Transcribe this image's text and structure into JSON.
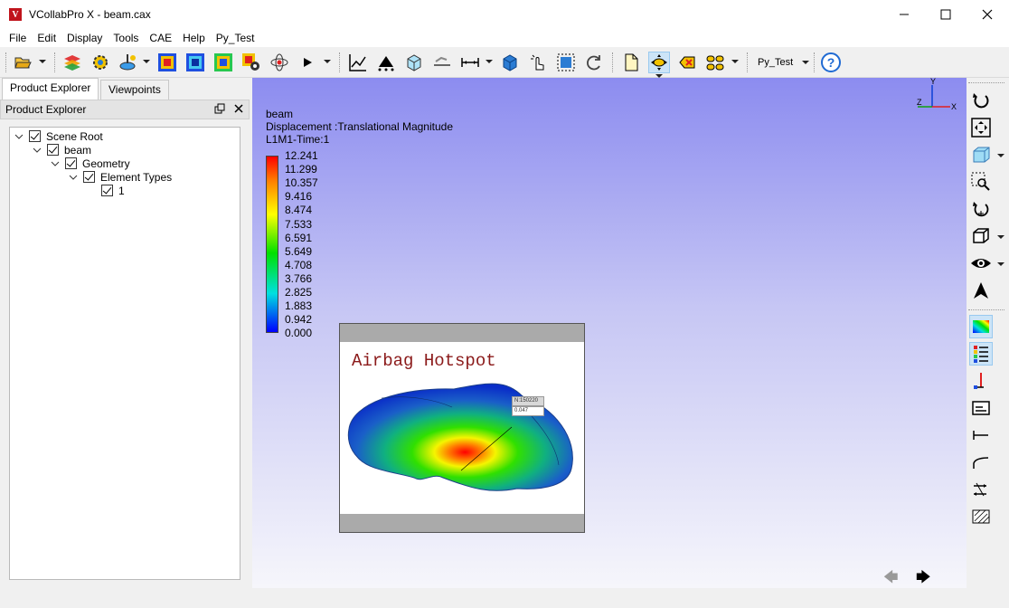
{
  "window": {
    "title": "VCollabPro X - beam.cax",
    "app_icon_letter": "V"
  },
  "menu": [
    "File",
    "Edit",
    "Display",
    "Tools",
    "CAE",
    "Help",
    "Py_Test"
  ],
  "toolbar": {
    "pytest_dropdown": "Py_Test"
  },
  "left_panel": {
    "tabs": [
      "Product Explorer",
      "Viewpoints"
    ],
    "active_tab": "Product Explorer",
    "header": "Product Explorer",
    "tree": [
      {
        "label": "Scene Root",
        "checked": true,
        "expanded": true
      },
      {
        "label": "beam",
        "checked": true,
        "expanded": true
      },
      {
        "label": "Geometry",
        "checked": true,
        "expanded": true
      },
      {
        "label": "Element Types",
        "checked": true,
        "expanded": true
      },
      {
        "label": "1",
        "checked": true
      }
    ]
  },
  "viewport": {
    "model_name": "beam",
    "result": "Displacement :Translational Magnitude",
    "step": "L1M1-Time:1",
    "legend": [
      "12.241",
      "11.299",
      "10.357",
      "9.416",
      "8.474",
      "7.533",
      "6.591",
      "5.649",
      "4.708",
      "3.766",
      "2.825",
      "1.883",
      "0.942",
      "0.000"
    ],
    "legend_colors": [
      "#ff0000",
      "#0000ff"
    ],
    "triad_labels": {
      "z": "Z",
      "y": "Y",
      "x": "X"
    }
  },
  "popup": {
    "title": "Airbag Hotspot",
    "note_node": "N:150220",
    "note_value": "0.047"
  }
}
